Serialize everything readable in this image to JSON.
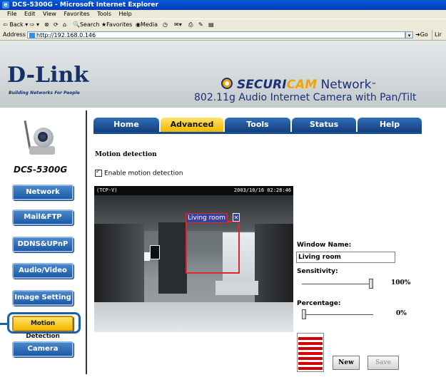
{
  "window": {
    "title": "DCS-5300G - Microsoft Internet Explorer"
  },
  "menubar": [
    "File",
    "Edit",
    "View",
    "Favorites",
    "Tools",
    "Help"
  ],
  "toolbar": {
    "back": "Back",
    "search": "Search",
    "favorites": "Favorites",
    "media": "Media"
  },
  "address": {
    "label": "Address",
    "url": "http://192.168.0.146",
    "go": "Go",
    "links": "Lir"
  },
  "brand": {
    "logo": "D-Link",
    "logo_sub": "Building Networks For People",
    "secur1": "SECURI",
    "secur2": "CAM",
    "network": " Network",
    "tm": "™",
    "tagline": "802.11g Audio Internet Camera with Pan/Tilt"
  },
  "sidebar": {
    "model": "DCS-5300G",
    "items": [
      {
        "label": "Network"
      },
      {
        "label": "Mail&FTP"
      },
      {
        "label": "DDNS&UPnP"
      },
      {
        "label": "Audio/Video"
      },
      {
        "label": "Image Setting"
      },
      {
        "label": "Motion Detection",
        "active": true
      },
      {
        "label": "Camera Control"
      }
    ]
  },
  "tabs": [
    {
      "label": "Home"
    },
    {
      "label": "Advanced",
      "active": true
    },
    {
      "label": "Tools"
    },
    {
      "label": "Status"
    },
    {
      "label": "Help"
    }
  ],
  "main": {
    "section_title": "Motion detection",
    "enable_label": "Enable motion detection",
    "enable_checked": true,
    "video": {
      "source": "(TCP-V)",
      "timestamp": "2003/10/16 02:28:46"
    },
    "window_label": "Living room",
    "form": {
      "window_name_label": "Window Name:",
      "window_name_value": "Living room",
      "sensitivity_label": "Sensitivity:",
      "sensitivity_value": "100%",
      "sensitivity_level": 1.0,
      "percentage_label": "Percentage:",
      "percentage_value": "0%",
      "percentage_level": 0.0
    },
    "meter_level_bars": 7,
    "new_button": "New",
    "save_button": "Save"
  },
  "colors": {
    "accent": "#1d5ea8",
    "active_tab": "#f0b800",
    "meter": "#d40000",
    "window_border": "#e0262b"
  }
}
